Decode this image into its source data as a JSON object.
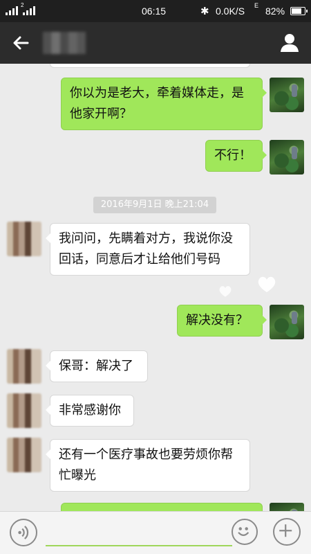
{
  "status": {
    "sim_num": "2",
    "time": "06:15",
    "bluetooth": "✱",
    "speed": "0.0K/S",
    "network": "E",
    "battery_text": "82%",
    "battery_level": 0.82
  },
  "header": {
    "back_icon": "arrow-left-icon",
    "profile_icon": "person-icon"
  },
  "chat": {
    "timestamp": "2016年9月1日 晚上21:04",
    "messages": [
      {
        "side": "out",
        "text": "你以为是老大，牵着媒体走，是他家开啊？"
      },
      {
        "side": "out",
        "text": "不行！"
      },
      {
        "side": "in",
        "text": "我问问，先瞒着对方，我说你没回话，同意后才让给他们号码"
      },
      {
        "side": "out",
        "text": "解决没有？"
      },
      {
        "side": "in",
        "text": "保哥：解决了"
      },
      {
        "side": "in",
        "text": "非常感谢你"
      },
      {
        "side": "in",
        "text": "还有一个医疗事故也要劳烦你帮忙曝光"
      }
    ]
  },
  "input": {
    "voice_icon": "voice-icon",
    "emoji_icon": "emoji-icon",
    "plus_icon": "plus-icon"
  },
  "colors": {
    "outgoing_bubble": "#a0e75a",
    "incoming_bubble": "#ffffff",
    "header": "#2c2c2c",
    "background": "#ebebeb"
  }
}
